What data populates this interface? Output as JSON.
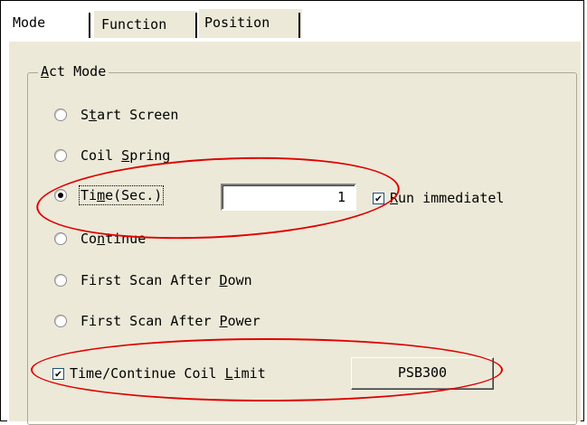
{
  "tabs": [
    {
      "label": "Mode"
    },
    {
      "label": "Function"
    },
    {
      "label": "Position"
    }
  ],
  "group": {
    "legend_prefix": "",
    "legend_ul": "A",
    "legend_rest": "ct Mode"
  },
  "radios": [
    {
      "pre": "S",
      "ul": "t",
      "post": "art Screen",
      "checked": false
    },
    {
      "pre": "Coil ",
      "ul": "S",
      "post": "pring",
      "checked": false
    },
    {
      "pre": "Ti",
      "ul": "m",
      "post": "e(Sec.)",
      "checked": true
    },
    {
      "pre": "Co",
      "ul": "n",
      "post": "tinue",
      "checked": false
    },
    {
      "pre": "First Scan After ",
      "ul": "D",
      "post": "own",
      "checked": false
    },
    {
      "pre": "First Scan After ",
      "ul": "P",
      "post": "ower",
      "checked": false
    }
  ],
  "time_value": "1",
  "run_immediate": {
    "pre": "",
    "ul": "R",
    "post": "un immediatel",
    "checked": true
  },
  "coil_limit": {
    "pre": "Time/Continue Coil ",
    "ul": "L",
    "post": "imit",
    "checked": true
  },
  "coil_button": {
    "label": "PSB300"
  },
  "colors": {
    "annotation": "#e00000",
    "panel": "#ece9d8"
  }
}
